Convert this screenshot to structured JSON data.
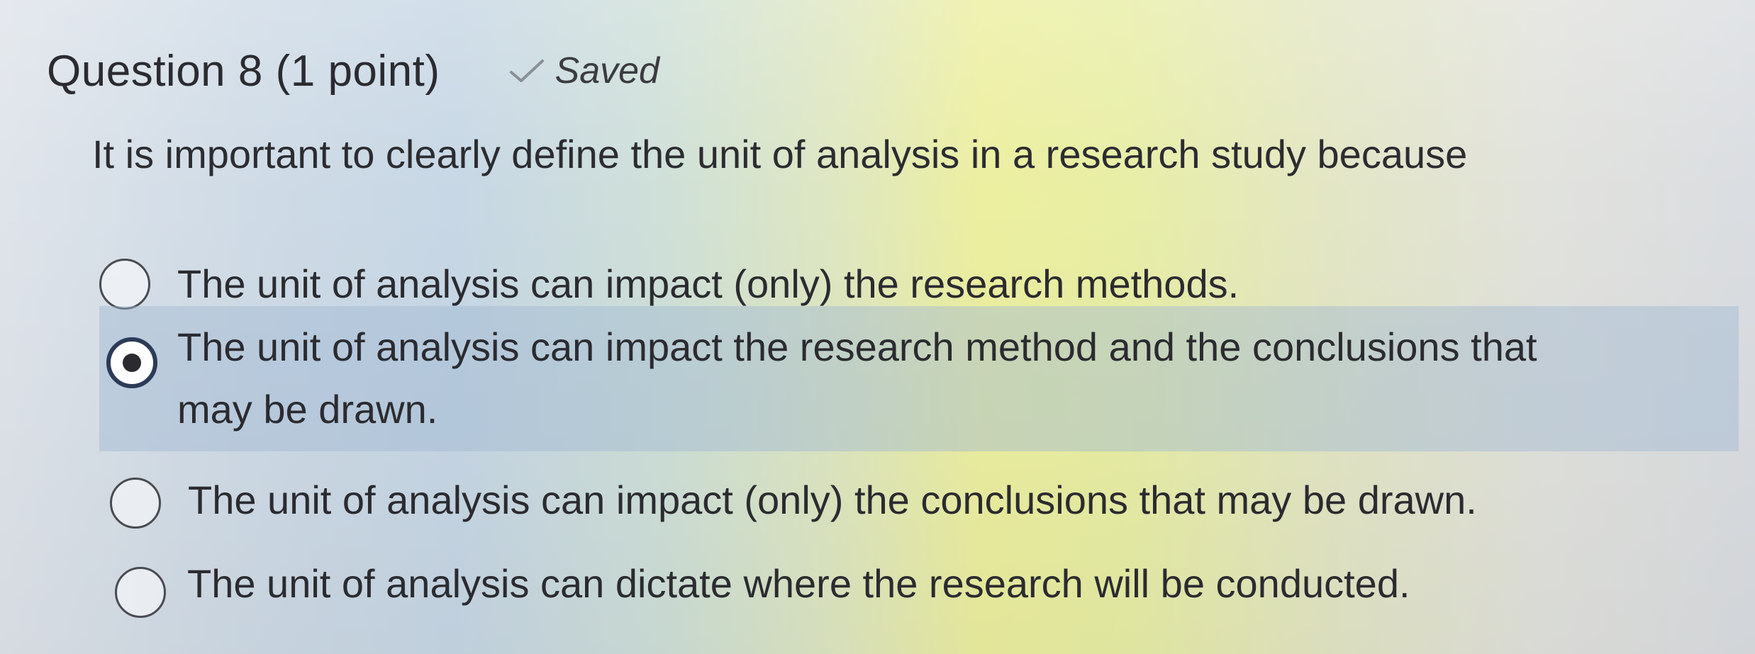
{
  "question": {
    "title": "Question 8 (1 point)",
    "status": "Saved",
    "status_icon": "check-icon",
    "prompt": "It is important to clearly define the unit of analysis in a research study because"
  },
  "options": [
    {
      "label": "The unit of analysis can impact (only) the research methods.",
      "selected": false
    },
    {
      "label_line1": "The unit of analysis can impact the research method and the conclusions that",
      "label_line2": "may be drawn.",
      "selected": true
    },
    {
      "label": "The unit of analysis can impact (only) the conclusions that may be drawn.",
      "selected": false
    },
    {
      "label": "The unit of analysis can dictate where the research will be conducted.",
      "selected": false
    }
  ],
  "colors": {
    "selected_highlight": "#a0b9d2",
    "radio_ring_selected": "#2c3b57",
    "text": "#2b2b30"
  }
}
